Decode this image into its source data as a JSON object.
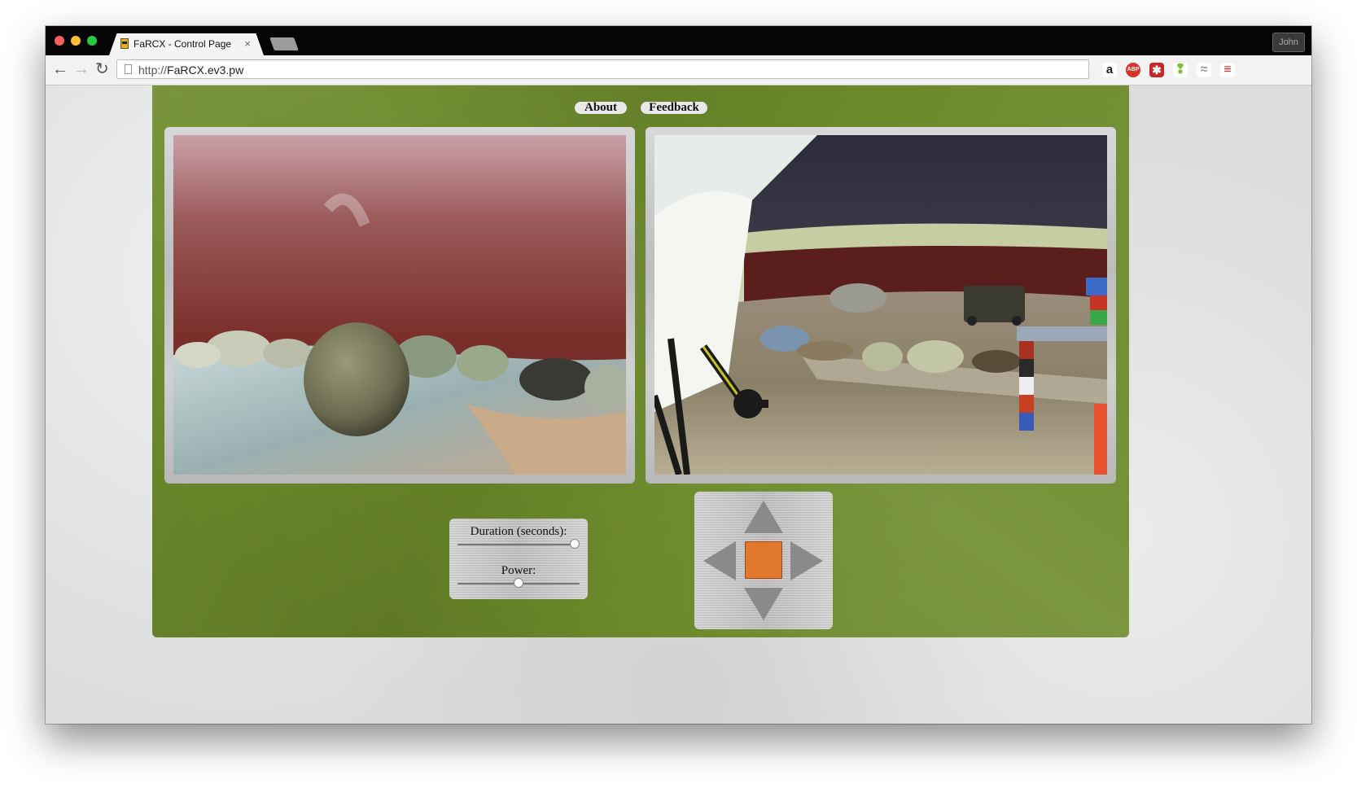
{
  "browser": {
    "tab_title": "FaRCX - Control Page",
    "tab_close": "×",
    "url_protocol": "http://",
    "url_host": "FaRCX.ev3.pw",
    "profile_name": "John",
    "nav": {
      "back": "←",
      "forward": "→",
      "reload": "↻"
    },
    "extensions": [
      {
        "name": "amazon-icon",
        "glyph": "a"
      },
      {
        "name": "adblock-plus-icon",
        "glyph": "ABP"
      },
      {
        "name": "lastpass-icon",
        "glyph": "✱"
      },
      {
        "name": "evernote-icon",
        "glyph": "❢"
      },
      {
        "name": "extension-wave-icon",
        "glyph": "≈"
      },
      {
        "name": "chrome-menu-icon",
        "glyph": "≡"
      }
    ]
  },
  "page": {
    "nav_links": {
      "about": "About",
      "feedback": "Feedback"
    },
    "cameras": [
      {
        "name": "front-camera-feed",
        "scene": "close-up of round rock on terrain"
      },
      {
        "name": "overview-camera-feed",
        "scene": "arena overview with rover and lego tower"
      }
    ],
    "settings": {
      "duration_label": "Duration (seconds):",
      "duration_fraction": 0.96,
      "power_label": "Power:",
      "power_fraction": 0.5
    },
    "dpad": {
      "up": "arrow-up-icon",
      "down": "arrow-down-icon",
      "left": "arrow-left-icon",
      "right": "arrow-right-icon",
      "stop": "stop-square-icon"
    }
  },
  "colors": {
    "panel_green": "#6c8a2a",
    "stop_orange": "#e2782c",
    "arrow_grey": "#8a8a8a"
  }
}
